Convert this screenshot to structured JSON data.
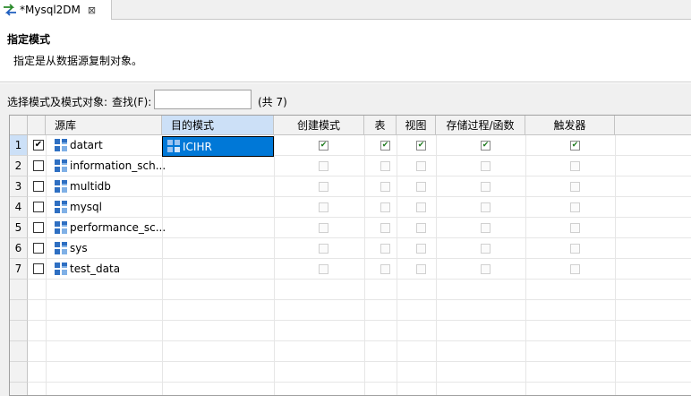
{
  "tab": {
    "title": "*Mysql2DM",
    "close": "⊠"
  },
  "header": {
    "title": "指定模式",
    "description": "指定是从数据源复制对象。"
  },
  "filter": {
    "label": "选择模式及模式对象:",
    "find_label": "查找(F):",
    "search_value": "",
    "count": "(共 7)"
  },
  "table": {
    "columns": [
      "源库",
      "目的模式",
      "创建模式",
      "表",
      "视图",
      "存储过程/函数",
      "触发器"
    ],
    "rows": [
      {
        "num": "1",
        "checked": true,
        "source": "datart",
        "target": "ICIHR",
        "create": true,
        "table": true,
        "view": true,
        "proc": true,
        "trigger": true
      },
      {
        "num": "2",
        "checked": false,
        "source": "information_sch...",
        "target": "",
        "create": false,
        "table": false,
        "view": false,
        "proc": false,
        "trigger": false
      },
      {
        "num": "3",
        "checked": false,
        "source": "multidb",
        "target": "",
        "create": false,
        "table": false,
        "view": false,
        "proc": false,
        "trigger": false
      },
      {
        "num": "4",
        "checked": false,
        "source": "mysql",
        "target": "",
        "create": false,
        "table": false,
        "view": false,
        "proc": false,
        "trigger": false
      },
      {
        "num": "5",
        "checked": false,
        "source": "performance_sc...",
        "target": "",
        "create": false,
        "table": false,
        "view": false,
        "proc": false,
        "trigger": false
      },
      {
        "num": "6",
        "checked": false,
        "source": "sys",
        "target": "",
        "create": false,
        "table": false,
        "view": false,
        "proc": false,
        "trigger": false
      },
      {
        "num": "7",
        "checked": false,
        "source": "test_data",
        "target": "",
        "create": false,
        "table": false,
        "view": false,
        "proc": false,
        "trigger": false
      }
    ]
  },
  "colors": {
    "accent": "#0078d7",
    "header_sel": "#cce0f7",
    "check": "#1e7b1e"
  }
}
